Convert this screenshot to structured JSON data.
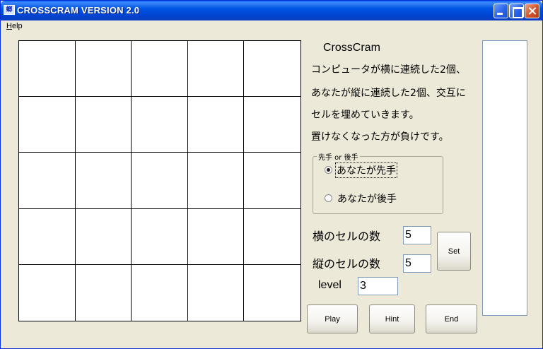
{
  "window": {
    "icon_text": "螂",
    "title": "CROSSCRAM VERSION 2.0"
  },
  "menu": {
    "help": "Help"
  },
  "board": {
    "rows": 5,
    "cols": 5
  },
  "info": {
    "app_name": "CrossCram",
    "line1": "コンピュータが横に連続した2個、",
    "line2": "あなたが縦に連続した2個、交互に",
    "line3": "セルを埋めていきます。",
    "line4": "置けなくなった方が負けです。"
  },
  "turn_group": {
    "legend": "先手 or 後手",
    "options": [
      {
        "label": "あなたが先手",
        "checked": true
      },
      {
        "label": "あなたが後手",
        "checked": false
      }
    ]
  },
  "settings": {
    "width_label": "横のセルの数",
    "width_value": "5",
    "height_label": "縦のセルの数",
    "height_value": "5",
    "level_label": "level",
    "level_value": "3",
    "set_label": "Set"
  },
  "buttons": {
    "play": "Play",
    "hint": "Hint",
    "end": "End"
  }
}
